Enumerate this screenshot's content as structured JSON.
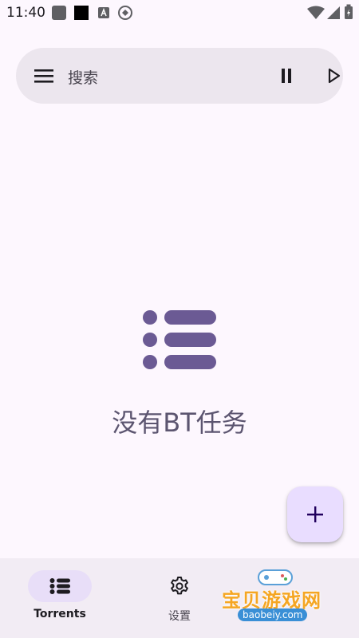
{
  "status_bar": {
    "time": "11:40",
    "icons": [
      "notification-square-icon",
      "notification-square-black-icon",
      "a-icon",
      "sync-icon"
    ],
    "right_icons": [
      "wifi-icon",
      "signal-icon",
      "battery-icon"
    ]
  },
  "search": {
    "label": "搜索",
    "icons": {
      "menu": "menu-icon",
      "pause": "pause-icon",
      "play": "play-icon"
    }
  },
  "empty_state": {
    "icon": "list-icon",
    "message": "没有BT任务",
    "color": "#5c5570"
  },
  "fab": {
    "icon": "plus-icon",
    "color": "#e9ddff"
  },
  "bottom_nav": {
    "items": [
      {
        "label": "Torrents",
        "icon": "list-icon",
        "active": true
      },
      {
        "label": "设置",
        "icon": "gear-icon",
        "active": false
      }
    ]
  },
  "watermark": {
    "text": "宝贝游戏网",
    "url": "baobeiy.com"
  },
  "colors": {
    "background": "#fdf7fe",
    "search_bar": "#ece6ee",
    "nav_bar": "#f2ecf4",
    "nav_indicator": "#e8def8",
    "accent": "#6750a4"
  }
}
